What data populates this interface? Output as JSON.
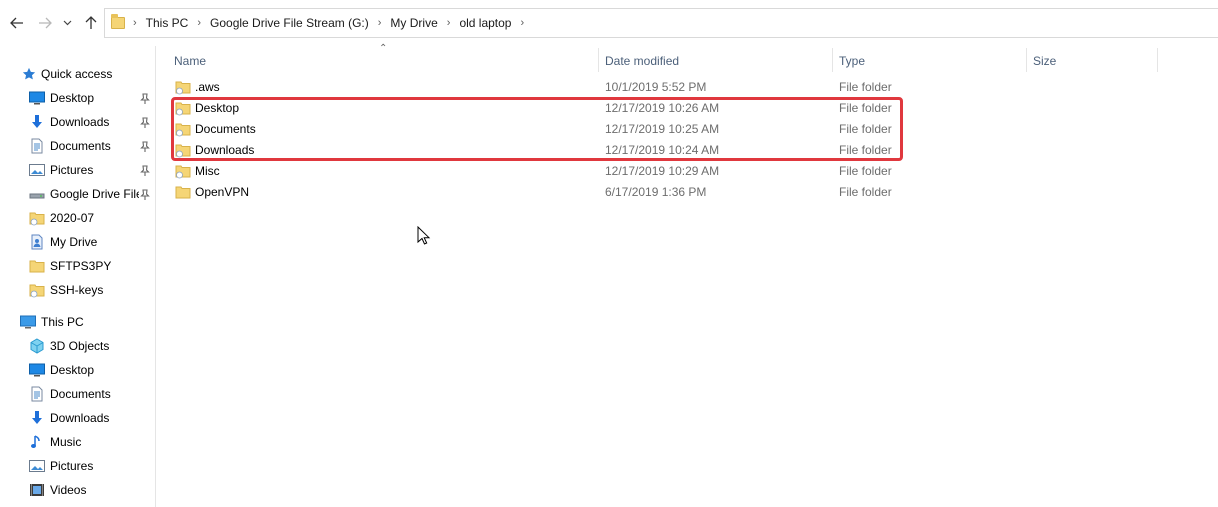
{
  "breadcrumbs": [
    "This PC",
    "Google Drive File Stream (G:)",
    "My Drive",
    "old laptop"
  ],
  "columns": {
    "name": "Name",
    "date": "Date modified",
    "type": "Type",
    "size": "Size"
  },
  "quick_access": {
    "label": "Quick access",
    "items": [
      {
        "label": "Desktop",
        "icon": "desktop-icon",
        "pinned": true
      },
      {
        "label": "Downloads",
        "icon": "download-arrow-icon",
        "pinned": true
      },
      {
        "label": "Documents",
        "icon": "document-icon",
        "pinned": true
      },
      {
        "label": "Pictures",
        "icon": "pictures-icon",
        "pinned": true
      },
      {
        "label": "Google Drive File",
        "icon": "drive-icon",
        "pinned": true
      },
      {
        "label": "2020-07",
        "icon": "folder-sync-icon",
        "pinned": false
      },
      {
        "label": "My Drive",
        "icon": "my-drive-icon",
        "pinned": false
      },
      {
        "label": "SFTPS3PY",
        "icon": "folder-icon",
        "pinned": false
      },
      {
        "label": "SSH-keys",
        "icon": "folder-sync-icon",
        "pinned": false
      }
    ]
  },
  "this_pc": {
    "label": "This PC",
    "items": [
      {
        "label": "3D Objects",
        "icon": "3d-objects-icon"
      },
      {
        "label": "Desktop",
        "icon": "desktop-icon"
      },
      {
        "label": "Documents",
        "icon": "document-icon"
      },
      {
        "label": "Downloads",
        "icon": "download-arrow-icon"
      },
      {
        "label": "Music",
        "icon": "music-icon"
      },
      {
        "label": "Pictures",
        "icon": "pictures-icon"
      },
      {
        "label": "Videos",
        "icon": "videos-icon"
      }
    ]
  },
  "files": [
    {
      "name": ".aws",
      "date": "10/1/2019 5:52 PM",
      "type": "File folder"
    },
    {
      "name": "Desktop",
      "date": "12/17/2019 10:26 AM",
      "type": "File folder"
    },
    {
      "name": "Documents",
      "date": "12/17/2019 10:25 AM",
      "type": "File folder"
    },
    {
      "name": "Downloads",
      "date": "12/17/2019 10:24 AM",
      "type": "File folder"
    },
    {
      "name": "Misc",
      "date": "12/17/2019 10:29 AM",
      "type": "File folder"
    },
    {
      "name": "OpenVPN",
      "date": "6/17/2019 1:36 PM",
      "type": "File folder"
    }
  ],
  "colors": {
    "highlight": "#e0383e",
    "header_text": "#4c607a",
    "folder": "#f5d576"
  }
}
